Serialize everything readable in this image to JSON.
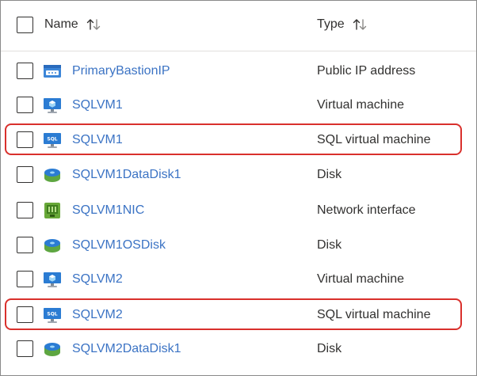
{
  "columns": {
    "name": "Name",
    "type": "Type"
  },
  "rows": [
    {
      "name": "PrimaryBastionIP",
      "type": "Public IP address",
      "icon": "public-ip-icon"
    },
    {
      "name": "SQLVM1",
      "type": "Virtual machine",
      "icon": "virtual-machine-icon"
    },
    {
      "name": "SQLVM1",
      "type": "SQL virtual machine",
      "icon": "sql-vm-icon",
      "highlighted": true
    },
    {
      "name": "SQLVM1DataDisk1",
      "type": "Disk",
      "icon": "disk-icon"
    },
    {
      "name": "SQLVM1NIC",
      "type": "Network interface",
      "icon": "network-interface-icon"
    },
    {
      "name": "SQLVM1OSDisk",
      "type": "Disk",
      "icon": "disk-icon"
    },
    {
      "name": "SQLVM2",
      "type": "Virtual machine",
      "icon": "virtual-machine-icon"
    },
    {
      "name": "SQLVM2",
      "type": "SQL virtual machine",
      "icon": "sql-vm-icon",
      "highlighted": true
    },
    {
      "name": "SQLVM2DataDisk1",
      "type": "Disk",
      "icon": "disk-icon"
    }
  ],
  "colors": {
    "link": "#3b73c4",
    "highlight": "#d9302c",
    "text": "#323130"
  }
}
